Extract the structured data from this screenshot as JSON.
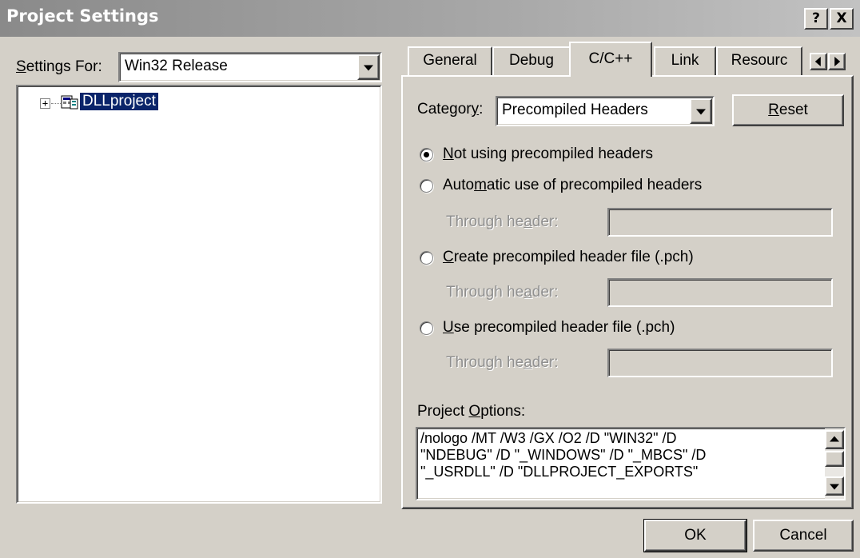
{
  "window": {
    "title": "Project Settings"
  },
  "caption_buttons": {
    "help": "?",
    "close": "X"
  },
  "settings_for": {
    "label_accel": "S",
    "label_rest": "ettings For:",
    "value": "Win32 Release"
  },
  "tree": {
    "expander": "+",
    "project": "DLLproject"
  },
  "tabs": [
    {
      "label": "General"
    },
    {
      "label": "Debug"
    },
    {
      "label": "C/C++"
    },
    {
      "label": "Link"
    },
    {
      "label": "Resourc"
    }
  ],
  "category": {
    "label_pre": "Categor",
    "label_accel": "y",
    "label_post": ":",
    "value": "Precompiled Headers"
  },
  "reset_button": {
    "accel": "R",
    "rest": "eset"
  },
  "radios": [
    {
      "pre": "",
      "accel": "N",
      "post": "ot using precompiled headers",
      "checked": true
    },
    {
      "pre": "Auto",
      "accel": "m",
      "post": "atic use of precompiled headers",
      "checked": false
    },
    {
      "pre": "",
      "accel": "C",
      "post": "reate precompiled header file (.pch)",
      "checked": false
    },
    {
      "pre": "",
      "accel": "U",
      "post": "se precompiled header file (.pch)",
      "checked": false
    }
  ],
  "through_header": {
    "pre": "Through he",
    "accel": "a",
    "post": "der:",
    "value": ""
  },
  "project_options": {
    "label_pre": "Project ",
    "label_accel": "O",
    "label_post": "ptions:",
    "text": "/nologo /MT /W3 /GX /O2 /D \"WIN32\" /D\n\"NDEBUG\" /D \"_WINDOWS\" /D \"_MBCS\" /D\n\"_USRDLL\" /D \"DLLPROJECT_EXPORTS\""
  },
  "buttons": {
    "ok": "OK",
    "cancel": "Cancel"
  }
}
